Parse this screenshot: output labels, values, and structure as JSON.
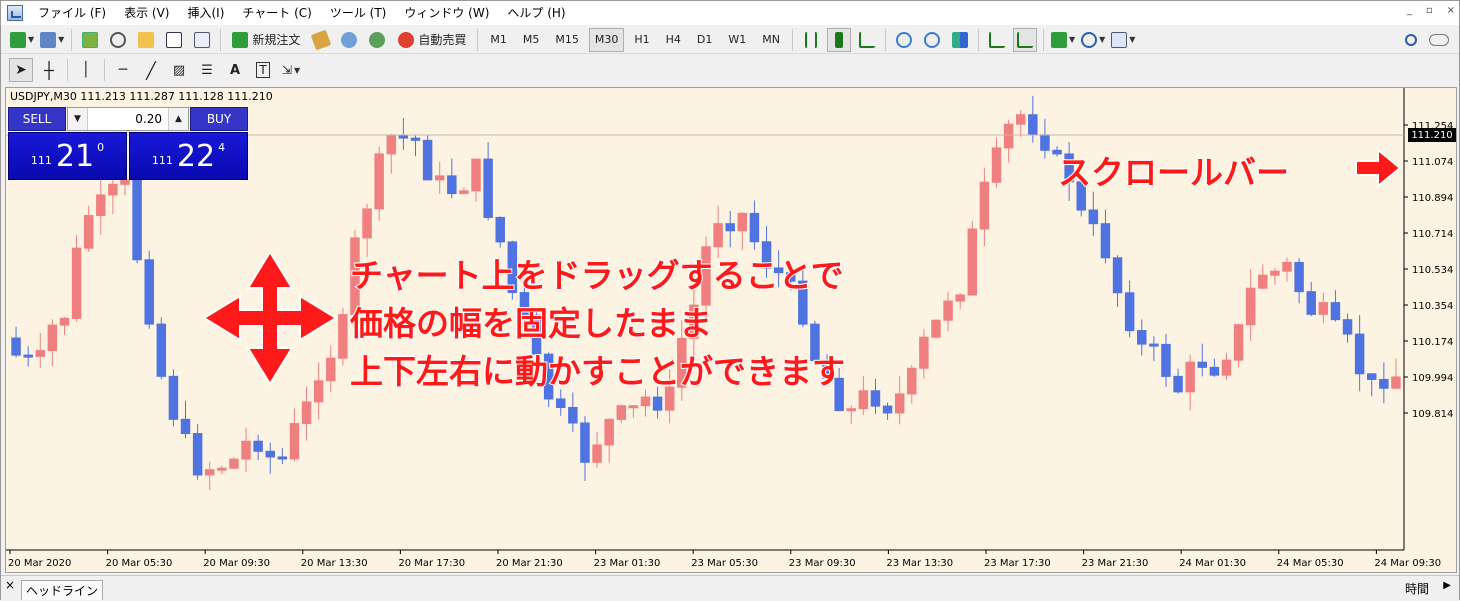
{
  "menubar": {
    "items": [
      "ファイル (F)",
      "表示 (V)",
      "挿入(I)",
      "チャート (C)",
      "ツール (T)",
      "ウィンドウ (W)",
      "ヘルプ (H)"
    ],
    "window_controls": [
      "_",
      "▫",
      "×"
    ]
  },
  "toolbar1": {
    "new_order_label": "新規注文",
    "auto_trade_label": "自動売買",
    "timeframes": [
      "M1",
      "M5",
      "M15",
      "M30",
      "H1",
      "H4",
      "D1",
      "W1",
      "MN"
    ],
    "active_timeframe": "M30"
  },
  "chart": {
    "symbol_label": "USDJPY,M30  111.213 111.287 111.128 111.210",
    "current_price": "111.210",
    "price_axis": [
      "111.254",
      "111.074",
      "110.894",
      "110.714",
      "110.534",
      "110.354",
      "110.174",
      "109.994",
      "109.814"
    ],
    "time_axis": [
      "20 Mar 2020",
      "20 Mar 05:30",
      "20 Mar 09:30",
      "20 Mar 13:30",
      "20 Mar 17:30",
      "20 Mar 21:30",
      "23 Mar 01:30",
      "23 Mar 05:30",
      "23 Mar 09:30",
      "23 Mar 13:30",
      "23 Mar 17:30",
      "23 Mar 21:30",
      "24 Mar 01:30",
      "24 Mar 05:30",
      "24 Mar 09:30"
    ],
    "bull_color": "#f08080",
    "bear_color": "#4f73e0",
    "background": "#fdf3e2"
  },
  "one_click": {
    "sell_label": "SELL",
    "buy_label": "BUY",
    "volume": "0.20",
    "bid_small": "111",
    "bid_big": "21",
    "bid_sup": "0",
    "ask_small": "111",
    "ask_big": "22",
    "ask_sup": "4"
  },
  "annotations": {
    "drag_line1": "チャート上をドラッグすることで",
    "drag_line2": "価格の幅を固定したまま",
    "drag_line3": "上下左右に動かすことができます",
    "scrollbar": "スクロールバー",
    "color": "#ff1a1a"
  },
  "bottombar": {
    "close": "×",
    "tab_label": "ヘッドライン",
    "time_label": "時間"
  }
}
